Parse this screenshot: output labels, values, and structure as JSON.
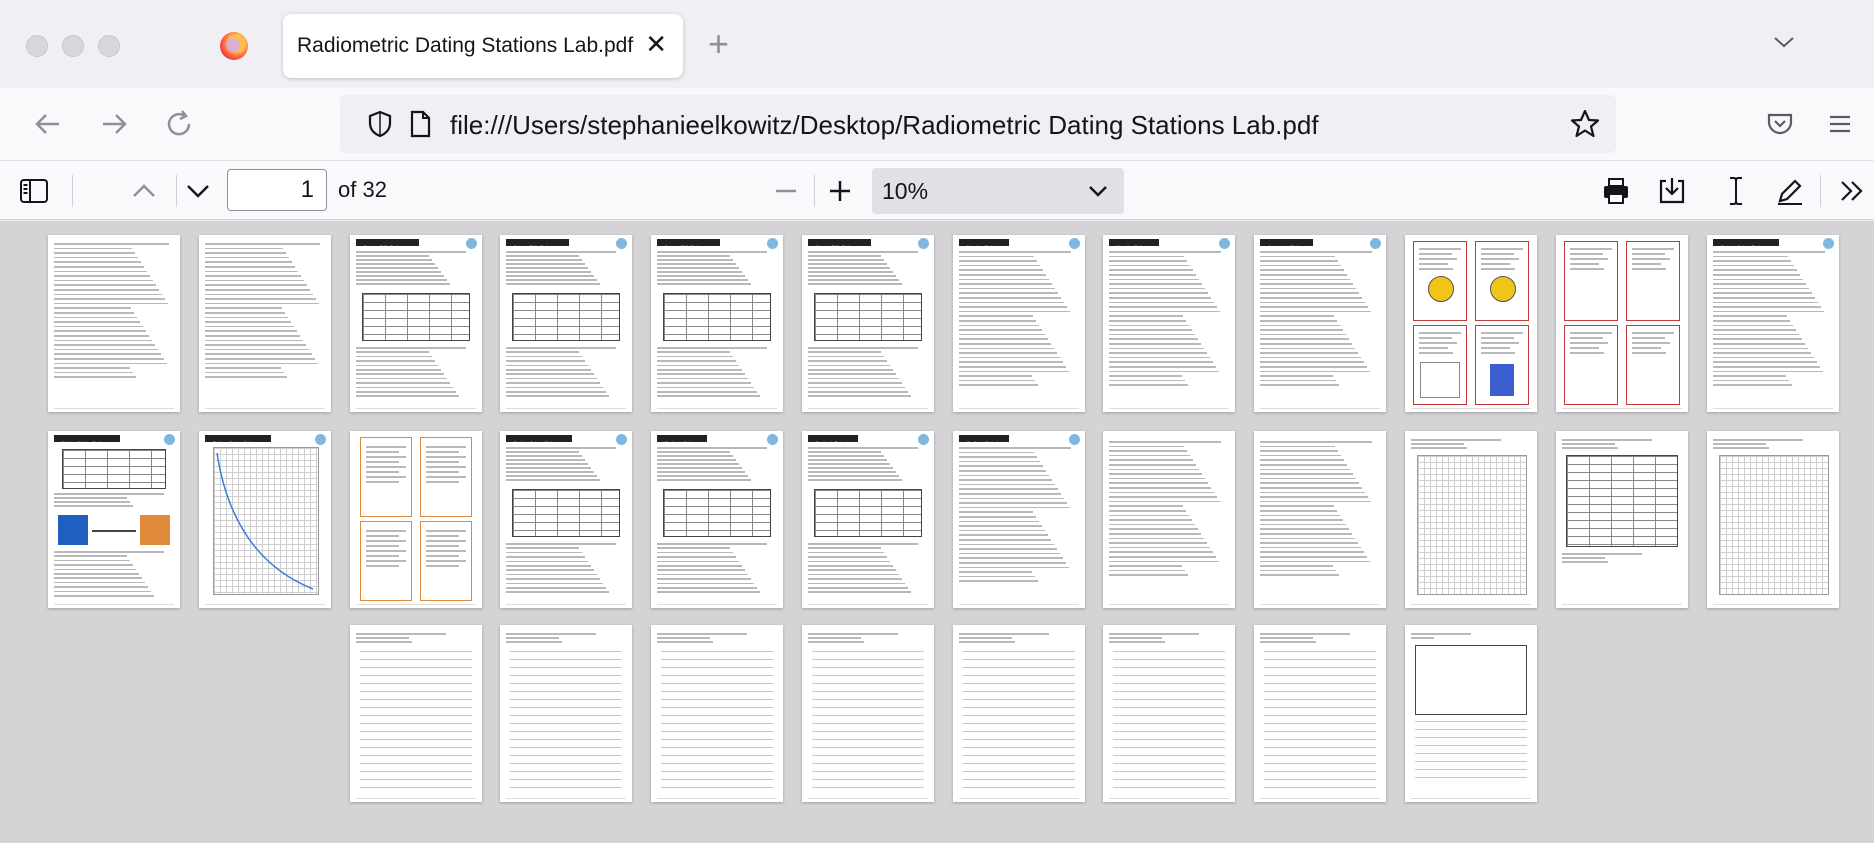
{
  "tab": {
    "title": "Radiometric Dating Stations Lab.pdf"
  },
  "address_bar": {
    "url": "file:///Users/stephanieelkowitz/Desktop/Radiometric Dating Stations Lab.pdf"
  },
  "pdf_toolbar": {
    "page_number": "1",
    "page_count_label": "of 32",
    "zoom": "10%",
    "total_pages": 32
  },
  "icons": {
    "close": "close-icon",
    "new_tab": "plus-icon",
    "back": "back-arrow-icon",
    "forward": "forward-arrow-icon",
    "reload": "reload-icon",
    "shield": "tracking-protection-shield-icon",
    "page": "local-file-icon",
    "bookmark": "bookmark-star-icon",
    "pocket": "pocket-icon",
    "menu": "hamburger-menu-icon",
    "sidebar": "sidebar-toggle-icon",
    "prev": "previous-page-icon",
    "next": "next-page-icon",
    "zoom_out": "zoom-out-icon",
    "zoom_in": "zoom-in-icon",
    "print": "print-icon",
    "save": "download-icon",
    "text_select": "text-cursor-icon",
    "draw": "draw-pen-icon",
    "more": "more-tools-icon"
  },
  "colors": {
    "accent_orange": "#e08a3c",
    "accent_red": "#c23b3b",
    "viewer_bg": "#d4d4d7",
    "toolbar_bg": "#f9f9fb"
  },
  "pages": [
    {
      "type": "text"
    },
    {
      "type": "text"
    },
    {
      "type": "station-table",
      "header": "Science Skills Station"
    },
    {
      "type": "station-table",
      "header": "Science Skills Station"
    },
    {
      "type": "station-table",
      "header": "Science Skills Station"
    },
    {
      "type": "station-table",
      "header": "Science Skills Station"
    },
    {
      "type": "station-text",
      "header": "Narrative Station"
    },
    {
      "type": "station-text",
      "header": "Narrative Station"
    },
    {
      "type": "station-text",
      "header": "Assessment Station"
    },
    {
      "type": "cards-red"
    },
    {
      "type": "cards-red"
    },
    {
      "type": "station-text",
      "header": "Problem-Solving Station"
    },
    {
      "type": "station-diagram",
      "header": "Problem-Solving Station"
    },
    {
      "type": "station-graph",
      "header": "Problem-Solving Station"
    },
    {
      "type": "cards-orange"
    },
    {
      "type": "station-table",
      "header": "Problem-Solving Station"
    },
    {
      "type": "station-table",
      "header": "Synthesis Station"
    },
    {
      "type": "station-table",
      "header": "Synthesis Project"
    },
    {
      "type": "station-text",
      "header": "Synthesis Project"
    },
    {
      "type": "answer-text"
    },
    {
      "type": "answer-text"
    },
    {
      "type": "answer-graph"
    },
    {
      "type": "answer-table"
    },
    {
      "type": "answer-graph"
    },
    {
      "type": "answer-lines"
    },
    {
      "type": "answer-lines"
    },
    {
      "type": "answer-lines"
    },
    {
      "type": "answer-lines"
    },
    {
      "type": "answer-lines"
    },
    {
      "type": "answer-lines"
    },
    {
      "type": "answer-lines"
    },
    {
      "type": "answer-boxes"
    }
  ]
}
